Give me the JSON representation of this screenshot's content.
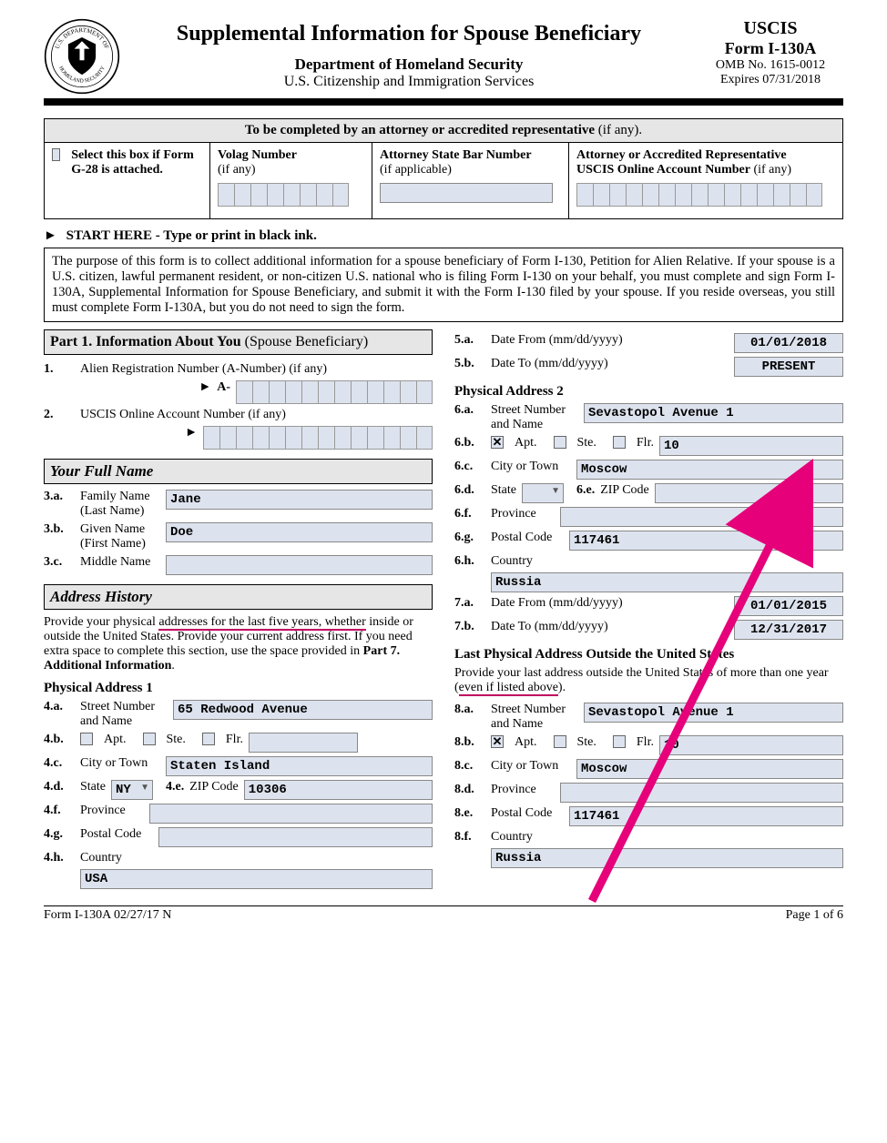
{
  "header": {
    "title": "Supplemental Information for Spouse Beneficiary",
    "dept": "Department of Homeland Security",
    "agency": "U.S. Citizenship and Immigration Services",
    "uscis": "USCIS",
    "formno": "Form I-130A",
    "omb": "OMB No. 1615-0012",
    "expires": "Expires 07/31/2018"
  },
  "attorney": {
    "heading_a": "To be completed by an attorney or accredited representative",
    "heading_b": " (if any).",
    "g28": "Select this box if Form G-28 is attached.",
    "volag_a": "Volag Number",
    "volag_b": "(if any)",
    "bar_a": "Attorney State Bar Number",
    "bar_b": "(if applicable)",
    "acct_a": "Attorney or Accredited Representative",
    "acct_b": "USCIS Online Account Number",
    "acct_c": " (if any)"
  },
  "start": "START HERE - Type or print in black ink.",
  "purpose": "The purpose of this form is to collect additional information for a spouse beneficiary of Form I-130, Petition for Alien Relative.  If your spouse is a U.S. citizen, lawful permanent resident, or non-citizen U.S. national who is filing Form I-130 on your behalf, you must complete and sign Form I-130A, Supplemental Information for Spouse Beneficiary, and submit it with the Form I-130 filed by your spouse.  If you reside overseas, you still must complete Form I-130A, but you do not need to sign the form.",
  "part1": {
    "title_a": "Part 1.  Information About You",
    "title_b": " (Spouse Beneficiary)",
    "q1": "Alien Registration Number (A-Number) (if any)",
    "aprefix": "A-",
    "q2": "USCIS Online Account Number (if any)"
  },
  "fullname": {
    "heading": "Your Full Name",
    "family_lbl": "Family Name (Last Name)",
    "given_lbl": "Given Name (First Name)",
    "middle_lbl": "Middle Name",
    "family_val": "Jane",
    "given_val": "Doe",
    "middle_val": ""
  },
  "addrhist": {
    "heading": "Address History",
    "instr_a": "Provide your physical ",
    "instr_u": "addresses for the last five years, whether",
    "instr_b": " inside or outside the United States.  Provide your current address first.  If you need extra space to complete this section, use the space provided in ",
    "instr_c": "Part 7. Additional Information",
    "instr_d": "."
  },
  "pa": {
    "street_lbl": "Street Number and Name",
    "apt": "Apt.",
    "ste": "Ste.",
    "flr": "Flr.",
    "city_lbl": "City or Town",
    "state_lbl": "State",
    "zip_lbl": "ZIP Code",
    "province_lbl": "Province",
    "postal_lbl": "Postal Code",
    "country_lbl": "Country",
    "datefrom_lbl": "Date From (mm/dd/yyyy)",
    "dateto_lbl": "Date To (mm/dd/yyyy)"
  },
  "pa1": {
    "heading": "Physical Address 1",
    "street": "65 Redwood Avenue",
    "unit": "",
    "city": "Staten Island",
    "state": "NY",
    "zip": "10306",
    "province": "",
    "postal": "",
    "country": "USA",
    "datefrom": "01/01/2018",
    "dateto": "PRESENT"
  },
  "pa2": {
    "heading": "Physical Address 2",
    "street": "Sevastopol Avenue 1",
    "unit": "10",
    "city": "Moscow",
    "state": "",
    "zip": "",
    "province": "",
    "postal": "117461",
    "country": "Russia",
    "datefrom": "01/01/2015",
    "dateto": "12/31/2017"
  },
  "lastout": {
    "heading": "Last Physical Address Outside the United States",
    "instr_a": "Provide your last address outside the United States of more than one year (",
    "instr_u": "even if listed above",
    "instr_b": ").",
    "street": "Sevastopol Avenue 1",
    "unit": "10",
    "city": "Moscow",
    "province": "",
    "postal": "117461",
    "country": "Russia"
  },
  "footer": {
    "left": "Form I-130A   02/27/17   N",
    "right": "Page 1 of 6"
  },
  "nums": {
    "n1": "1.",
    "n2": "2.",
    "n3a": "3.a.",
    "n3b": "3.b.",
    "n3c": "3.c.",
    "n4a": "4.a.",
    "n4b": "4.b.",
    "n4c": "4.c.",
    "n4d": "4.d.",
    "n4e": "4.e.",
    "n4f": "4.f.",
    "n4g": "4.g.",
    "n4h": "4.h.",
    "n5a": "5.a.",
    "n5b": "5.b.",
    "n6a": "6.a.",
    "n6b": "6.b.",
    "n6c": "6.c.",
    "n6d": "6.d.",
    "n6e": "6.e.",
    "n6f": "6.f.",
    "n6g": "6.g.",
    "n6h": "6.h.",
    "n7a": "7.a.",
    "n7b": "7.b.",
    "n8a": "8.a.",
    "n8b": "8.b.",
    "n8c": "8.c.",
    "n8d": "8.d.",
    "n8e": "8.e.",
    "n8f": "8.f."
  }
}
